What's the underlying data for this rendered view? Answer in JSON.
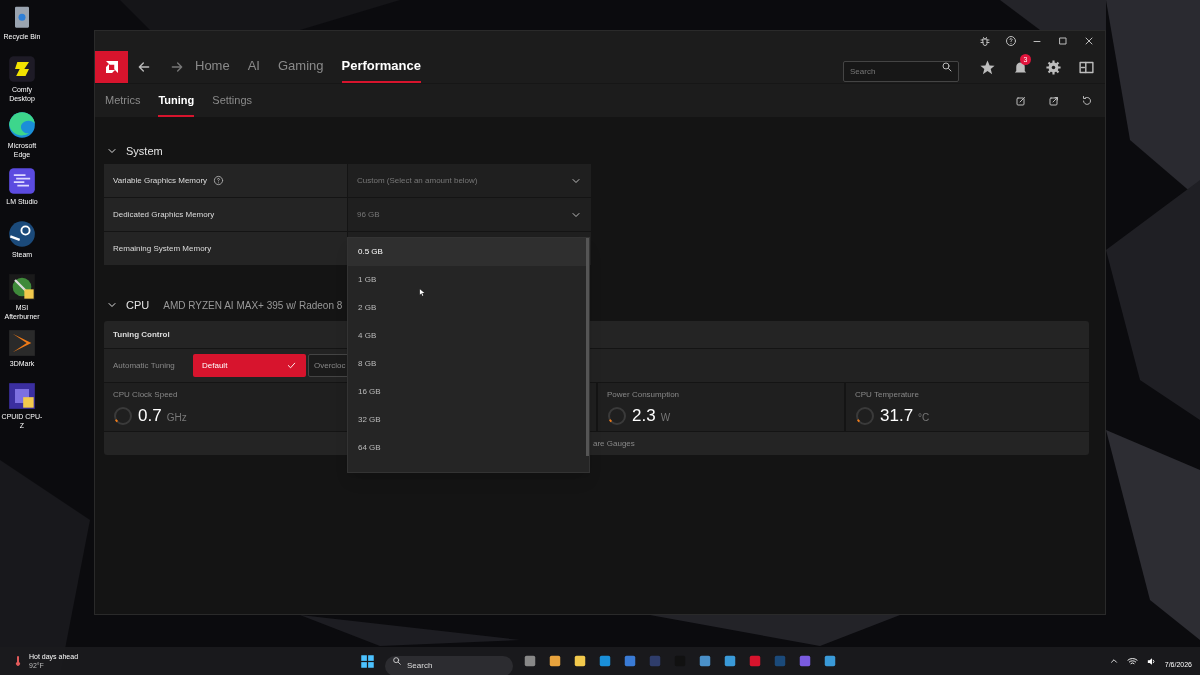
{
  "desktop_icons": [
    {
      "label": "Recycle Bin",
      "kind": "bin"
    },
    {
      "label": "Comfy Desktop",
      "kind": "comfy"
    },
    {
      "label": "Microsoft Edge",
      "kind": "edge"
    },
    {
      "label": "LM Studio",
      "kind": "lm"
    },
    {
      "label": "Steam",
      "kind": "steam"
    },
    {
      "label": "MSI Afterburner",
      "kind": "msi"
    },
    {
      "label": "3DMark",
      "kind": "mark"
    },
    {
      "label": "CPUID CPU-Z",
      "kind": "cpuz"
    }
  ],
  "window": {
    "nav_tabs": [
      {
        "label": "Home",
        "selected": false
      },
      {
        "label": "AI",
        "selected": false
      },
      {
        "label": "Gaming",
        "selected": false
      },
      {
        "label": "Performance",
        "selected": true
      }
    ],
    "search": {
      "placeholder": "Search"
    },
    "notification_count": "3",
    "sub_tabs": [
      {
        "label": "Metrics",
        "selected": false
      },
      {
        "label": "Tuning",
        "selected": true
      },
      {
        "label": "Settings",
        "selected": false
      }
    ],
    "system": {
      "title": "System",
      "expanded": true,
      "rows": [
        {
          "label": "Variable Graphics Memory",
          "help": true,
          "value": "Custom (Select an amount below)"
        },
        {
          "label": "Dedicated Graphics Memory",
          "help": false,
          "value": "96 GB"
        },
        {
          "label": "Remaining System Memory",
          "help": false
        }
      ]
    },
    "cpu": {
      "title": "CPU",
      "expanded": true,
      "model": "AMD RYZEN AI MAX+ 395 w/ Radeon 8",
      "tuning_control": {
        "title": "Tuning Control",
        "automatic_tuning": {
          "label": "Automatic Tuning",
          "options": [
            {
              "label": "Default",
              "selected": true
            },
            {
              "label": "Overcloc",
              "selected": false
            }
          ]
        },
        "gauges": [
          {
            "label": "CPU Clock Speed",
            "value": "0.7",
            "unit": "GHz"
          },
          {
            "label": "Power Consumption",
            "value": "2.3",
            "unit": "W"
          },
          {
            "label": "CPU Temperature",
            "value": "31.7",
            "unit": "°C"
          }
        ],
        "footer": "are Gauges"
      }
    },
    "dropdown": {
      "options": [
        {
          "label": "0.5 GB",
          "selected": true
        },
        {
          "label": "1 GB",
          "selected": false
        },
        {
          "label": "2 GB",
          "selected": false
        },
        {
          "label": "4 GB",
          "selected": false
        },
        {
          "label": "8 GB",
          "selected": false
        },
        {
          "label": "16 GB",
          "selected": false
        },
        {
          "label": "32 GB",
          "selected": false
        },
        {
          "label": "64 GB",
          "selected": false
        }
      ]
    }
  },
  "taskbar": {
    "weather": {
      "title": "Hot days ahead",
      "temperature": "92°F"
    },
    "search": {
      "placeholder": "Search"
    },
    "date": "7/6/2026"
  }
}
